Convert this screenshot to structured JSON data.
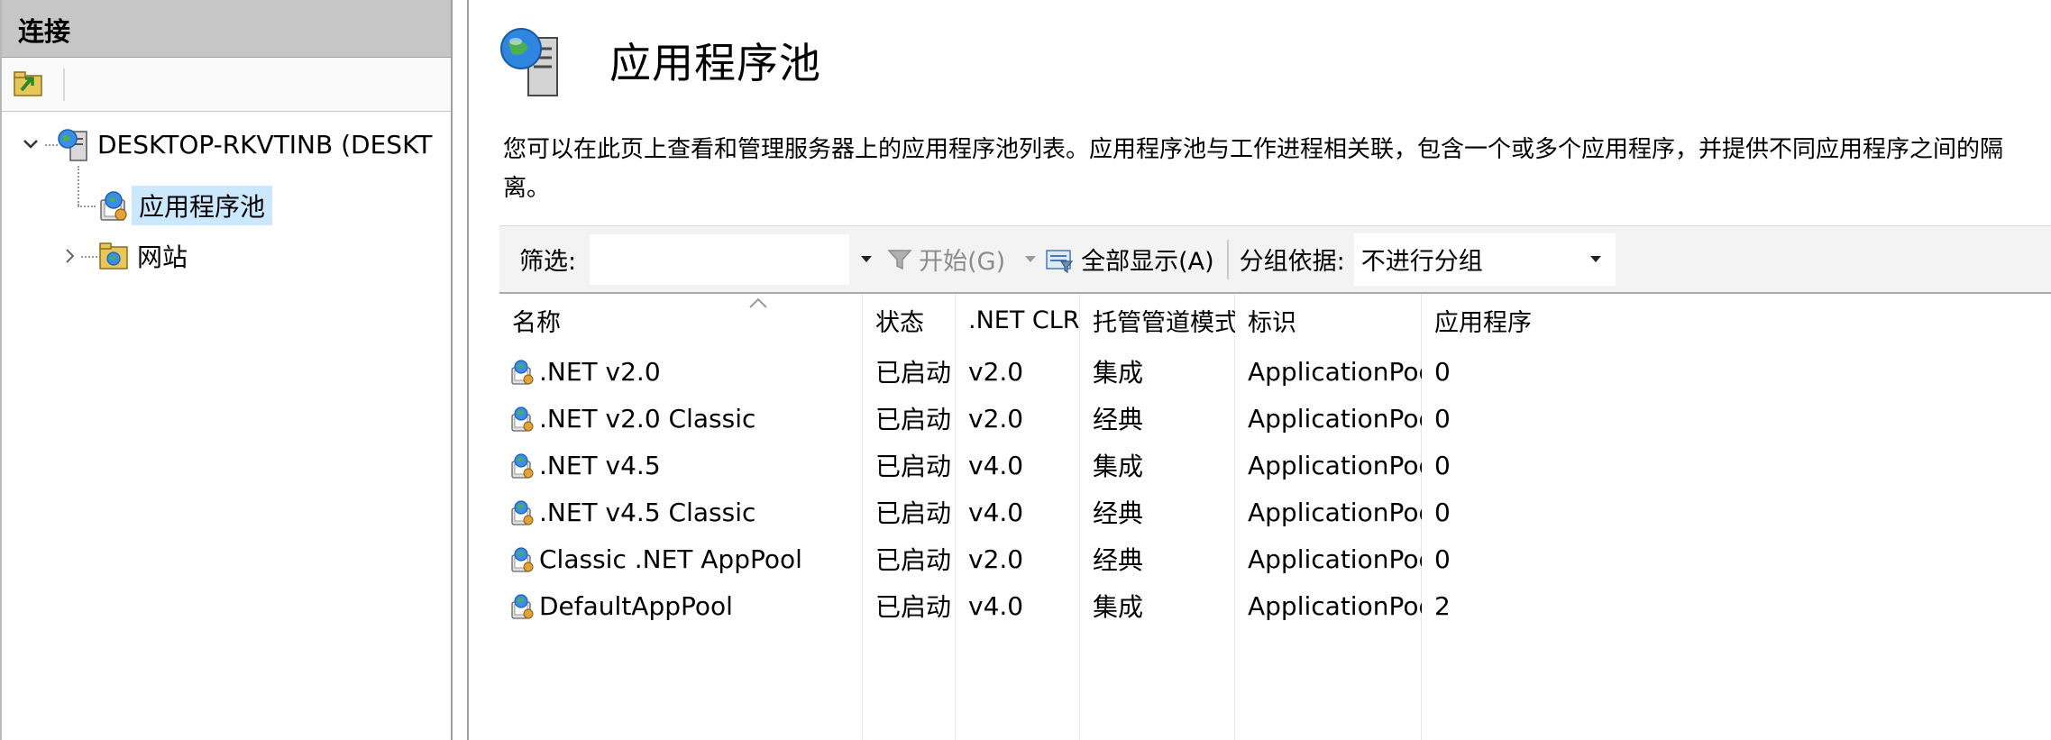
{
  "connections": {
    "title": "连接",
    "tree": {
      "server": "DESKTOP-RKVTINB (DESKT",
      "app_pools": "应用程序池",
      "sites": "网站"
    }
  },
  "main": {
    "title": "应用程序池",
    "description": "您可以在此页上查看和管理服务器上的应用程序池列表。应用程序池与工作进程相关联，包含一个或多个应用程序，并提供不同应用程序之间的隔离。",
    "filter_label": "筛选:",
    "filter_value": "",
    "start_label": "开始(G)",
    "show_all_label": "全部显示(A)",
    "group_label": "分组依据:",
    "group_value": "不进行分组",
    "columns": [
      "名称",
      "状态",
      ".NET CLR ...",
      "托管管道模式",
      "标识",
      "应用程序"
    ],
    "rows": [
      {
        "name": ".NET v2.0",
        "status": "已启动",
        "clr": "v2.0",
        "pipeline": "集成",
        "identity": "ApplicationPoolI...",
        "apps": "0"
      },
      {
        "name": ".NET v2.0 Classic",
        "status": "已启动",
        "clr": "v2.0",
        "pipeline": "经典",
        "identity": "ApplicationPoolI...",
        "apps": "0"
      },
      {
        "name": ".NET v4.5",
        "status": "已启动",
        "clr": "v4.0",
        "pipeline": "集成",
        "identity": "ApplicationPoolI...",
        "apps": "0"
      },
      {
        "name": ".NET v4.5 Classic",
        "status": "已启动",
        "clr": "v4.0",
        "pipeline": "经典",
        "identity": "ApplicationPoolI...",
        "apps": "0"
      },
      {
        "name": "Classic .NET AppPool",
        "status": "已启动",
        "clr": "v2.0",
        "pipeline": "经典",
        "identity": "ApplicationPoolI...",
        "apps": "0"
      },
      {
        "name": "DefaultAppPool",
        "status": "已启动",
        "clr": "v4.0",
        "pipeline": "集成",
        "identity": "ApplicationPoolI...",
        "apps": "2"
      }
    ]
  },
  "colors": {
    "header_gray": "#c6c6c6",
    "selection": "#cce8ff",
    "toolbar_bg": "#f3f3f3"
  }
}
